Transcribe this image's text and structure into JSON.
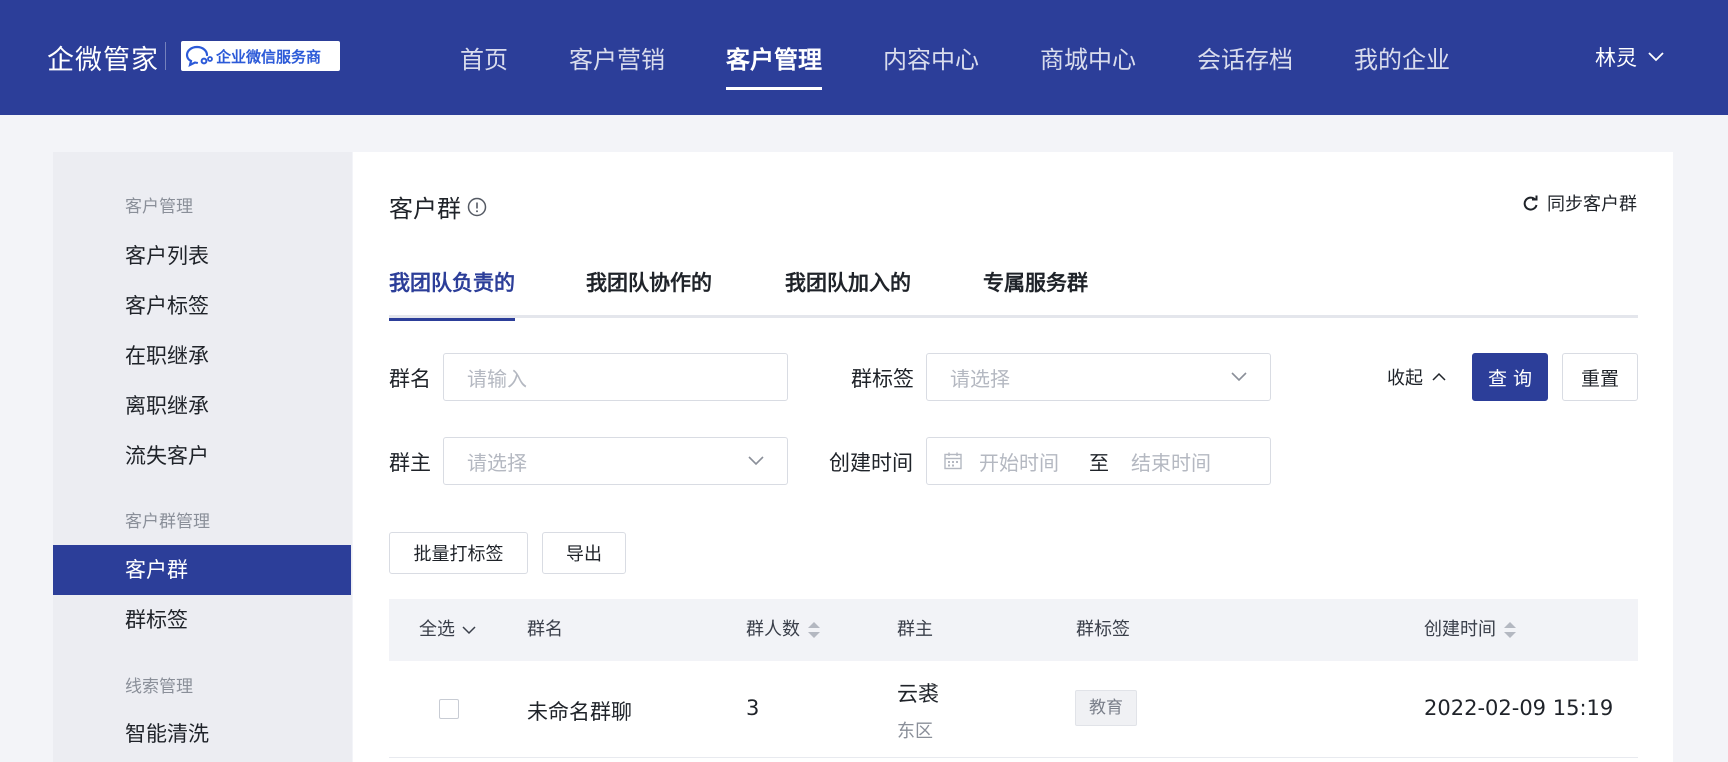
{
  "header": {
    "brand": "企微管家",
    "partner_badge": "企业微信服务商",
    "nav": [
      "首页",
      "客户营销",
      "客户管理",
      "内容中心",
      "商城中心",
      "会话存档",
      "我的企业"
    ],
    "active_nav": "客户管理",
    "user": "林灵"
  },
  "sidebar": {
    "groups": [
      {
        "title": "客户管理",
        "items": [
          "客户列表",
          "客户标签",
          "在职继承",
          "离职继承",
          "流失客户"
        ]
      },
      {
        "title": "客户群管理",
        "items": [
          "客户群",
          "群标签"
        ]
      },
      {
        "title": "线索管理",
        "items": [
          "智能清洗"
        ]
      }
    ],
    "active_item": "客户群"
  },
  "main": {
    "title": "客户群",
    "sync_label": "同步客户群",
    "tabs": [
      "我团队负责的",
      "我团队协作的",
      "我团队加入的",
      "专属服务群"
    ],
    "active_tab": "我团队负责的",
    "filters": {
      "group_name_label": "群名",
      "group_name_placeholder": "请输入",
      "group_tag_label": "群标签",
      "group_tag_placeholder": "请选择",
      "owner_label": "群主",
      "owner_placeholder": "请选择",
      "created_label": "创建时间",
      "start_placeholder": "开始时间",
      "to_label": "至",
      "end_placeholder": "结束时间"
    },
    "collapse_label": "收起",
    "query_label": "查 询",
    "reset_label": "重置",
    "batch_tag_label": "批量打标签",
    "export_label": "导出",
    "table": {
      "select_all": "全选",
      "columns": [
        "群名",
        "群人数",
        "群主",
        "群标签",
        "创建时间"
      ],
      "rows": [
        {
          "name": "未命名群聊",
          "count": "3",
          "owner": "云裘",
          "owner_dept": "东区",
          "tag": "教育",
          "created": "2022-02-09 15:19"
        }
      ]
    }
  }
}
